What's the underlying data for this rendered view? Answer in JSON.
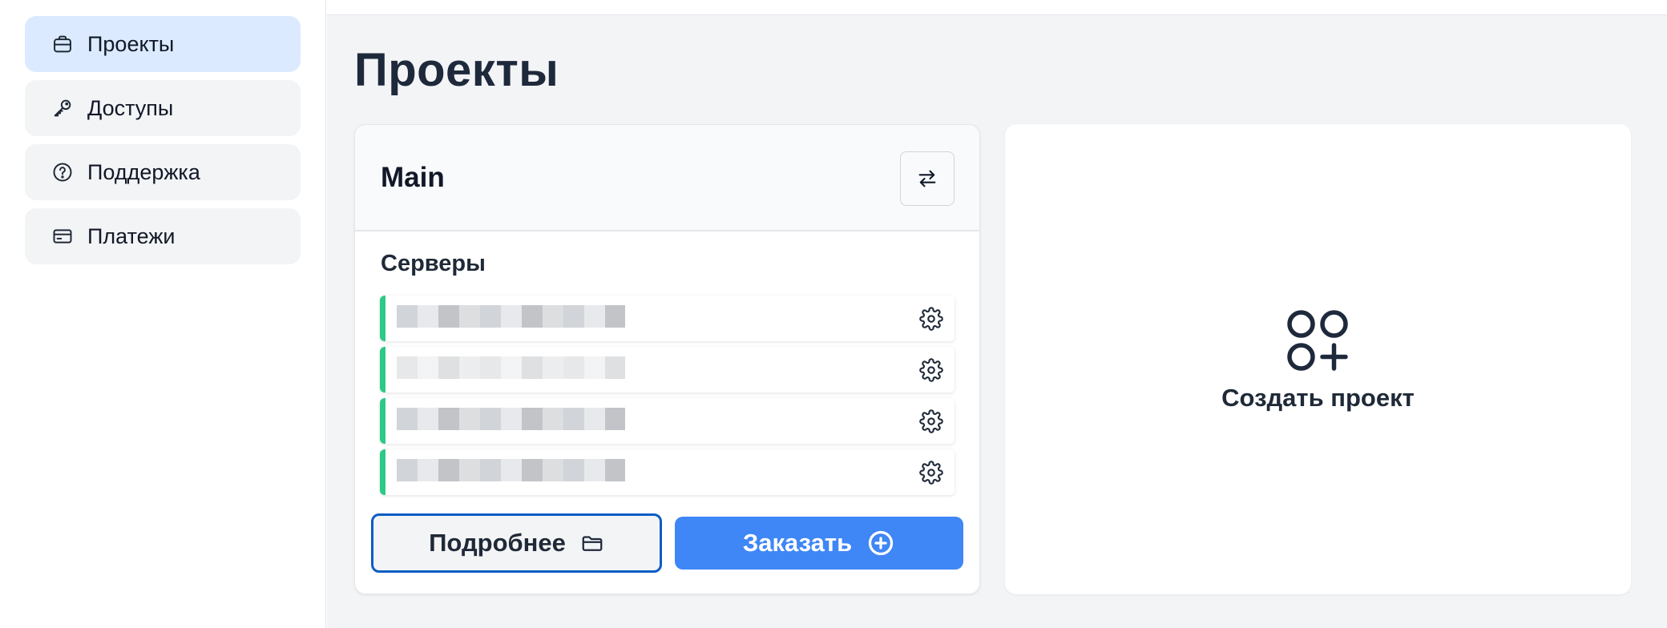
{
  "sidebar": {
    "items": [
      {
        "label": "Проекты",
        "icon": "briefcase-icon",
        "active": true
      },
      {
        "label": "Доступы",
        "icon": "key-icon",
        "active": false
      },
      {
        "label": "Поддержка",
        "icon": "help-circle-icon",
        "active": false
      },
      {
        "label": "Платежи",
        "icon": "credit-card-icon",
        "active": false
      }
    ]
  },
  "main": {
    "title": "Проекты",
    "project": {
      "name": "Main",
      "switch_icon": "swap-arrows-icon",
      "servers_heading": "Серверы",
      "servers": [
        {
          "status_color": "#2dc987",
          "name_redacted": true
        },
        {
          "status_color": "#2dc987",
          "name_redacted": true
        },
        {
          "status_color": "#2dc987",
          "name_redacted": true
        },
        {
          "status_color": "#2dc987",
          "name_redacted": true
        }
      ],
      "details_button": "Подробнее",
      "details_icon": "folder-icon",
      "order_button": "Заказать",
      "order_icon": "plus-circle-icon"
    },
    "create_card": {
      "label": "Создать проект",
      "icon": "grid-plus-icon"
    }
  },
  "colors": {
    "accent": "#3f86f6",
    "status_ok": "#2dc987",
    "active_nav": "#dbeafe",
    "focus_border": "#0b5dc4"
  }
}
